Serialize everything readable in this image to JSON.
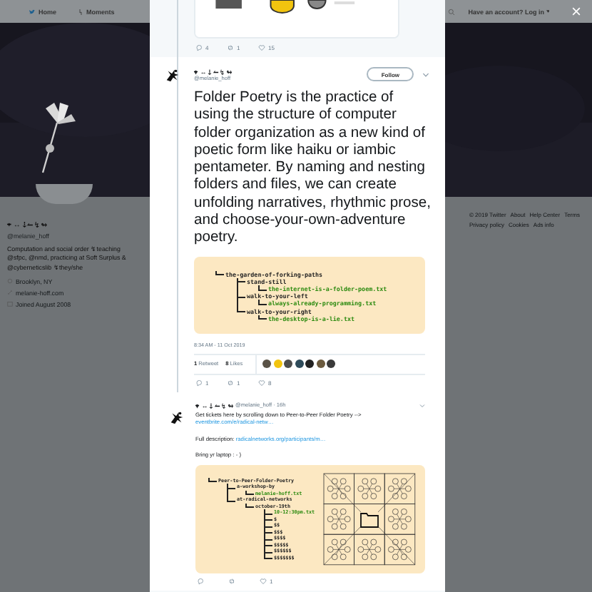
{
  "nav": {
    "items": [
      {
        "kind": "home",
        "label": "Home"
      },
      {
        "kind": "moments",
        "label": "Moments"
      }
    ],
    "login": "Have an account? Log in"
  },
  "profile": {
    "name": "⌖ ↔ ⇣ ↼ ↯ ↬",
    "handle": "@melanie_hoff",
    "bio": "Computation and social order ↯ teaching @sfpc, @nmd, practicing at Soft Surplus & @cyberneticslib ↯ they/she",
    "location": "Brooklyn, NY",
    "website": "melanie-hoff.com",
    "joined": "Joined August 2008"
  },
  "footer": [
    "© 2019 Twitter",
    "About",
    "Help Center",
    "Terms",
    "Privacy policy",
    "Cookies",
    "Ads info"
  ],
  "previous_tweet": {
    "actions": [
      {
        "kind": "reply",
        "count": "4"
      },
      {
        "kind": "retweet",
        "count": "1"
      },
      {
        "kind": "like",
        "count": "15"
      }
    ]
  },
  "tweet": {
    "name": "⌖ ↔ ⇣ ↼ ↯ ↬",
    "handle": "@melanie_hoff",
    "follow": "Follow",
    "text": "Folder Poetry is the practice of using the structure of computer folder organization as a new kind of poetic form like haiku or iambic pentameter. By naming and nesting folders and files, we can create unfolding narratives, rhythmic prose, and choose-your-own-adventure poetry.",
    "tree": [
      {
        "kind": "folder",
        "name": "the-garden-of-forking-paths",
        "children": [
          {
            "kind": "folder",
            "name": "stand-still",
            "children": [
              {
                "kind": "file",
                "name": "the-internet-is-a-folder-poem.txt"
              }
            ]
          },
          {
            "kind": "folder",
            "name": "walk-to-your-left",
            "children": [
              {
                "kind": "file",
                "name": "always-already-programming.txt"
              }
            ]
          },
          {
            "kind": "folder",
            "name": "walk-to-your-right",
            "children": [
              {
                "kind": "file",
                "name": "the-desktop-is-a-lie.txt"
              }
            ]
          }
        ]
      }
    ],
    "time": "8:34 AM - 11 Oct 2019",
    "retweets": "**1** Retweet",
    "likes": "**8** Likes",
    "likers": [
      {
        "color": "#5a5246"
      },
      {
        "color": "#f2c40f"
      },
      {
        "color": "#4d4d4d"
      },
      {
        "color": "#2e4b5a"
      },
      {
        "color": "#222222"
      },
      {
        "color": "#6b5a3e"
      },
      {
        "color": "#3a3a3a"
      }
    ],
    "actions": [
      {
        "kind": "reply",
        "count": "1"
      },
      {
        "kind": "retweet",
        "count": "1"
      },
      {
        "kind": "like",
        "count": "8"
      }
    ]
  },
  "reply": {
    "name": "⌖ ↔ ⇣ ↼ ↯ ↬",
    "meta": "@melanie_hoff · 16h",
    "paragraphs": [
      {
        "text": "Get tickets here by scrolling down to Peer-to-Peer Folder Poetry -->",
        "link": "eventbrite.com/e/radical-netw…"
      },
      {
        "text": "Full description:",
        "link": "radicalnetworks.org/participants/m…"
      },
      {
        "text": "Bring yr laptop : - )"
      }
    ],
    "tree": [
      {
        "kind": "folder",
        "name": "Peer-to-Peer-Folder-Poetry",
        "children": [
          {
            "kind": "folder",
            "name": "a-workshop-by",
            "children": [
              {
                "kind": "file",
                "name": "melanie-hoff.txt"
              }
            ]
          },
          {
            "kind": "folder",
            "name": "at-radical-networks",
            "children": [
              {
                "kind": "folder",
                "name": "october-19th",
                "children": [
                  {
                    "kind": "file",
                    "name": "10-12:30pm.txt"
                  },
                  {
                    "kind": "folder",
                    "name": "$"
                  },
                  {
                    "kind": "folder",
                    "name": "$$"
                  },
                  {
                    "kind": "folder",
                    "name": "$$$"
                  },
                  {
                    "kind": "folder",
                    "name": "$$$$"
                  },
                  {
                    "kind": "folder",
                    "name": "$$$$$"
                  },
                  {
                    "kind": "folder",
                    "name": "$$$$$$"
                  },
                  {
                    "kind": "folder",
                    "name": "$$$$$$$"
                  }
                ]
              }
            ]
          }
        ]
      }
    ],
    "actions": [
      {
        "kind": "reply"
      },
      {
        "kind": "retweet"
      },
      {
        "kind": "like",
        "count": "1"
      }
    ]
  }
}
